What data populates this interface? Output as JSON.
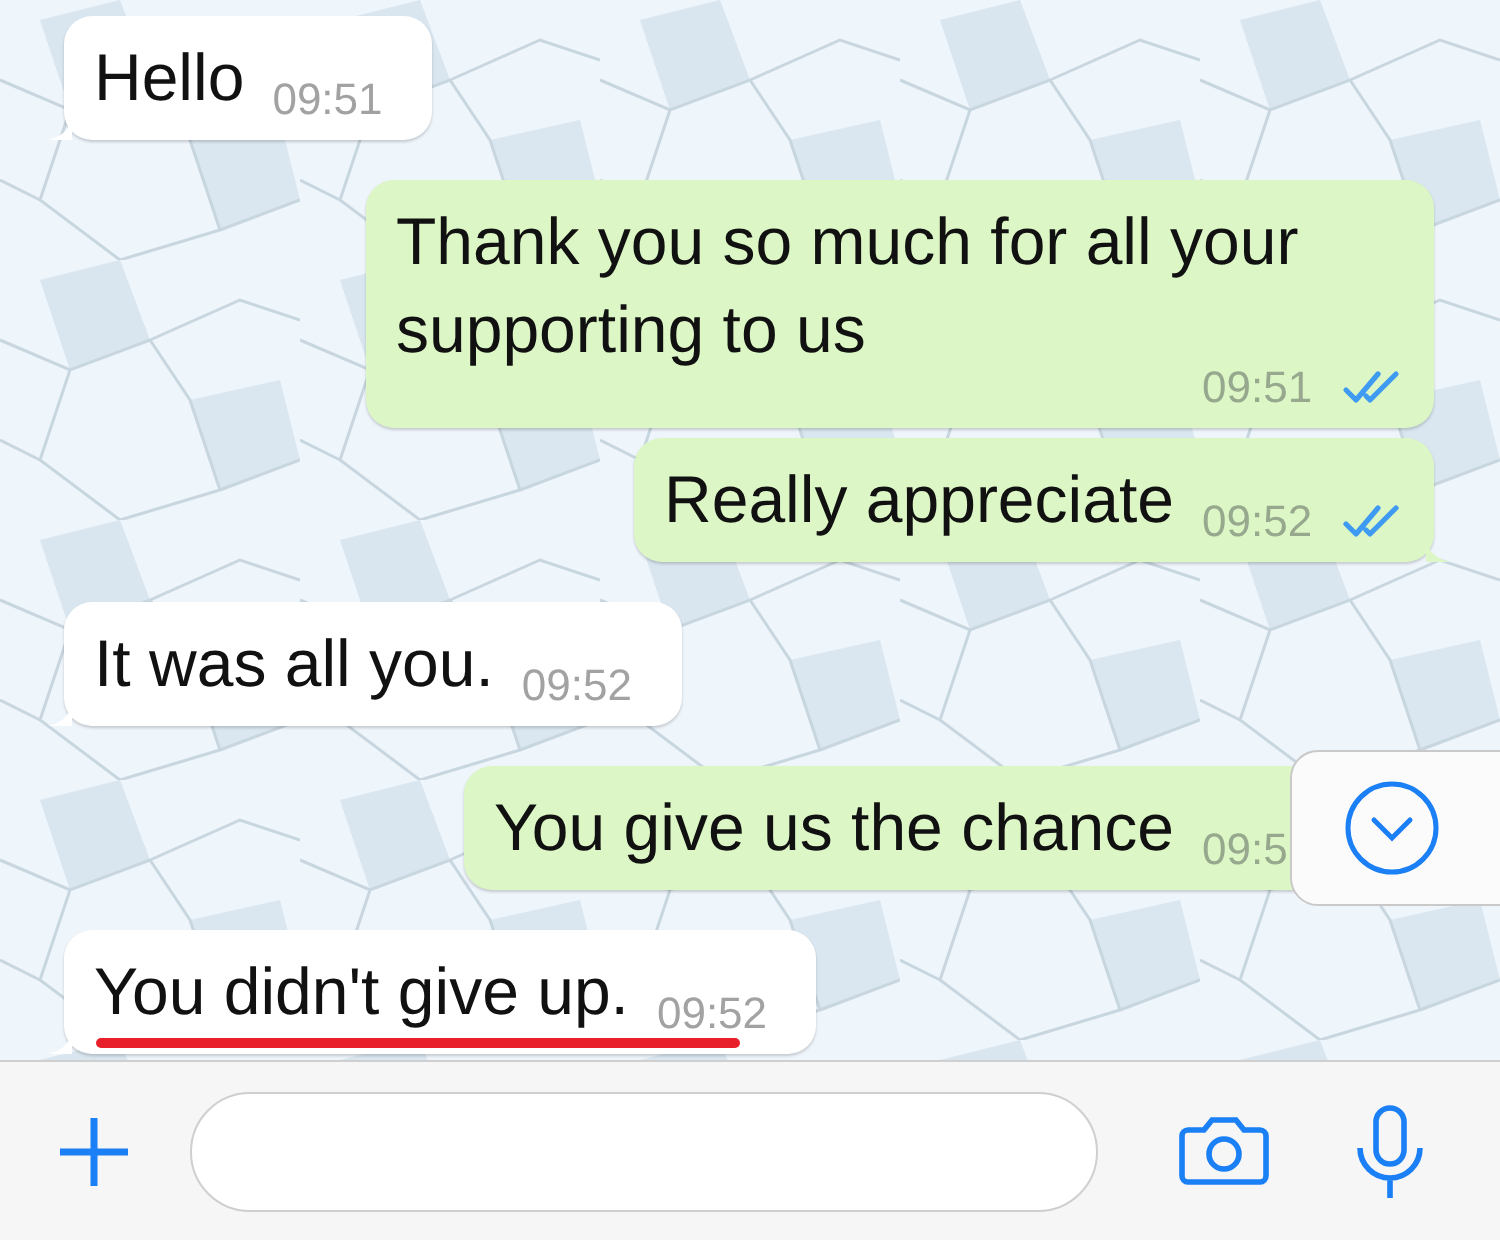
{
  "messages": [
    {
      "kind": "incoming",
      "text": "Hello",
      "time": "09:51",
      "tail": true,
      "underlined": false
    },
    {
      "kind": "outgoing",
      "text": "Thank you so much for all your supporting to us",
      "time": "09:51",
      "read": true,
      "tail": false,
      "underlined": false
    },
    {
      "kind": "outgoing",
      "text": "Really appreciate",
      "time": "09:52",
      "read": true,
      "tail": true,
      "underlined": false
    },
    {
      "kind": "incoming",
      "text": "It was all you.",
      "time": "09:52",
      "tail": true,
      "underlined": false
    },
    {
      "kind": "outgoing",
      "text": "You give us the chance",
      "time": "09:5",
      "tail": false,
      "underlined": false
    },
    {
      "kind": "incoming",
      "text": "You didn't give up.",
      "time": "09:52",
      "tail": true,
      "underlined": true
    }
  ],
  "scroll_down_button": {
    "visible": true
  }
}
